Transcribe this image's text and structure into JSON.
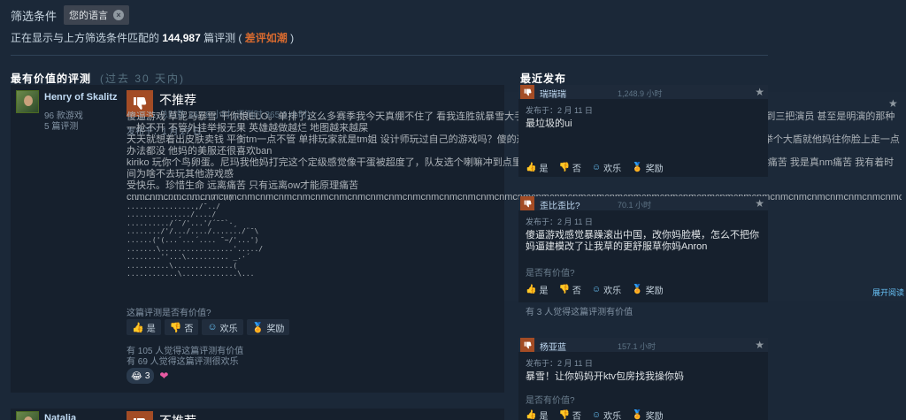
{
  "filter": {
    "label": "筛选条件",
    "chip": "您的语言"
  },
  "summary": {
    "prefix": "正在显示与上方筛选条件匹配的",
    "count": "144,987",
    "mid": "篇评测 (",
    "rating": "差评如潮",
    "suffix": ")"
  },
  "most_helpful": {
    "title": "最有价值的评测",
    "subtitle": "(过去 30 天内)"
  },
  "recent": {
    "title": "最近发布"
  },
  "review": {
    "author": "Henry of Skalitz",
    "games": "96 款游戏",
    "reviews": "5 篇评测",
    "verdict": "不推荐",
    "hours": "总时数 367.9 小时 (评测时 365.9 小时)",
    "posted": "发布于：1 月 27 日",
    "text_line1": "傻逼游戏 草泥马暴雪 干你娘ELO。单排了这么多赛季我今天真绷不住了 看我连胜就暴雪大手要发力了是吧 玄学匹配玄学对位 压根没有公平可言 匹配到三把演员 甚至是明演的那种 一枪不开 不管外挂举报无果 英雄越做越烂 地图越来越屎",
    "text_line2": "天天就想着出皮肤卖钱 平衡tm一点不管 单排玩家就是tm姐 设计师玩过自己的游戏吗？傻的这些平衡性改动什么玩意 天天玩过自己出的吗？西格玛tm举个大盾就他妈往你脸上走一点办法都没 他妈的美服还很喜欢ban",
    "text_line3": "kiriko 玩你个鸟卵蛋。尼玛我他妈打完这个定级感觉像干蛋被超度了，队友选个喇嘛冲到点里死了然后就发个报点：我方需要治疗 我他妈真感受尼玛的痛苦 我是真nm痛苦 我有着时间为啥不去玩其他游戏感",
    "text_line4": "受快乐。珍惜生命 远离痛苦 只有远离ow才能原理痛苦",
    "text_line5": "cnmcnmcnmcnmcnmcnmcnmcnmcnmcnmcnmcnmcnmcnmcnmcnmcnmcnmcnmcnmcnmcnmcnmcnmcnmcnmcnmcnmcnmcnmcnmcnmcnmcnmcnmcnmcnmcnmcnmcnmcnmcnmcnmcnmcnmcnmcnmcnmcnmcnmcnm",
    "ascii": "..................../´¯/)\n................,/¯../\n.............../..../\n........../´¯/'...'/´¯¯`·¸\n......../'/.../..../......./¨¯\\\n......('(...´...´.... ¯~/'...')\n.......\\.................'...../\n........''...\\.......... _.·´\n..........\\..............(\n............\\.............\\...",
    "helpful_q": "这篇评测是否有价值?",
    "yes": "是",
    "no": "否",
    "funny": "欢乐",
    "award": "奖励",
    "helpful_count": "有 105 人觉得这篇评测有价值",
    "funny_count": "有 69 人觉得这篇评测很欢乐",
    "award_count": "3"
  },
  "next_review": {
    "author": "Natalia",
    "verdict": "不推荐"
  },
  "recent_reviews": [
    {
      "user": "瑞瑞瑞",
      "hours": "1,248.9 小时",
      "posted": "发布于：2 月 11 日",
      "text": "最垃圾的ui",
      "q": "是否有价值?",
      "yes": "是",
      "no": "否",
      "funny": "欢乐",
      "award": "奖励"
    },
    {
      "user": "歪比歪比?",
      "hours": "70.1 小时",
      "posted": "发布于：2 月 11 日",
      "text": "傻逼游戏感觉暴躁滚出中国，改你妈脸模，怎么不把你妈逼建模改了让我草的更舒服草你妈Anron",
      "q": "是否有价值?",
      "yes": "是",
      "no": "否",
      "funny": "欢乐",
      "award": "奖励",
      "expand": "展开阅读",
      "helpful": "有 3 人觉得这篇评测有价值"
    },
    {
      "user": "杨亚蓝",
      "hours": "157.1 小时",
      "posted": "发布于：2 月 11 日",
      "text": "暴雪！让你妈妈开ktv包房找我操你妈",
      "q": "是否有价值?",
      "yes": "是",
      "no": "否",
      "funny": "欢乐",
      "award": "奖励"
    }
  ],
  "colors": {
    "background": "#1b2838",
    "card": "#16202d",
    "thumbs_down": "#a34c25",
    "mixed_rating": "#d76a2f",
    "link": "#67c1f5"
  }
}
